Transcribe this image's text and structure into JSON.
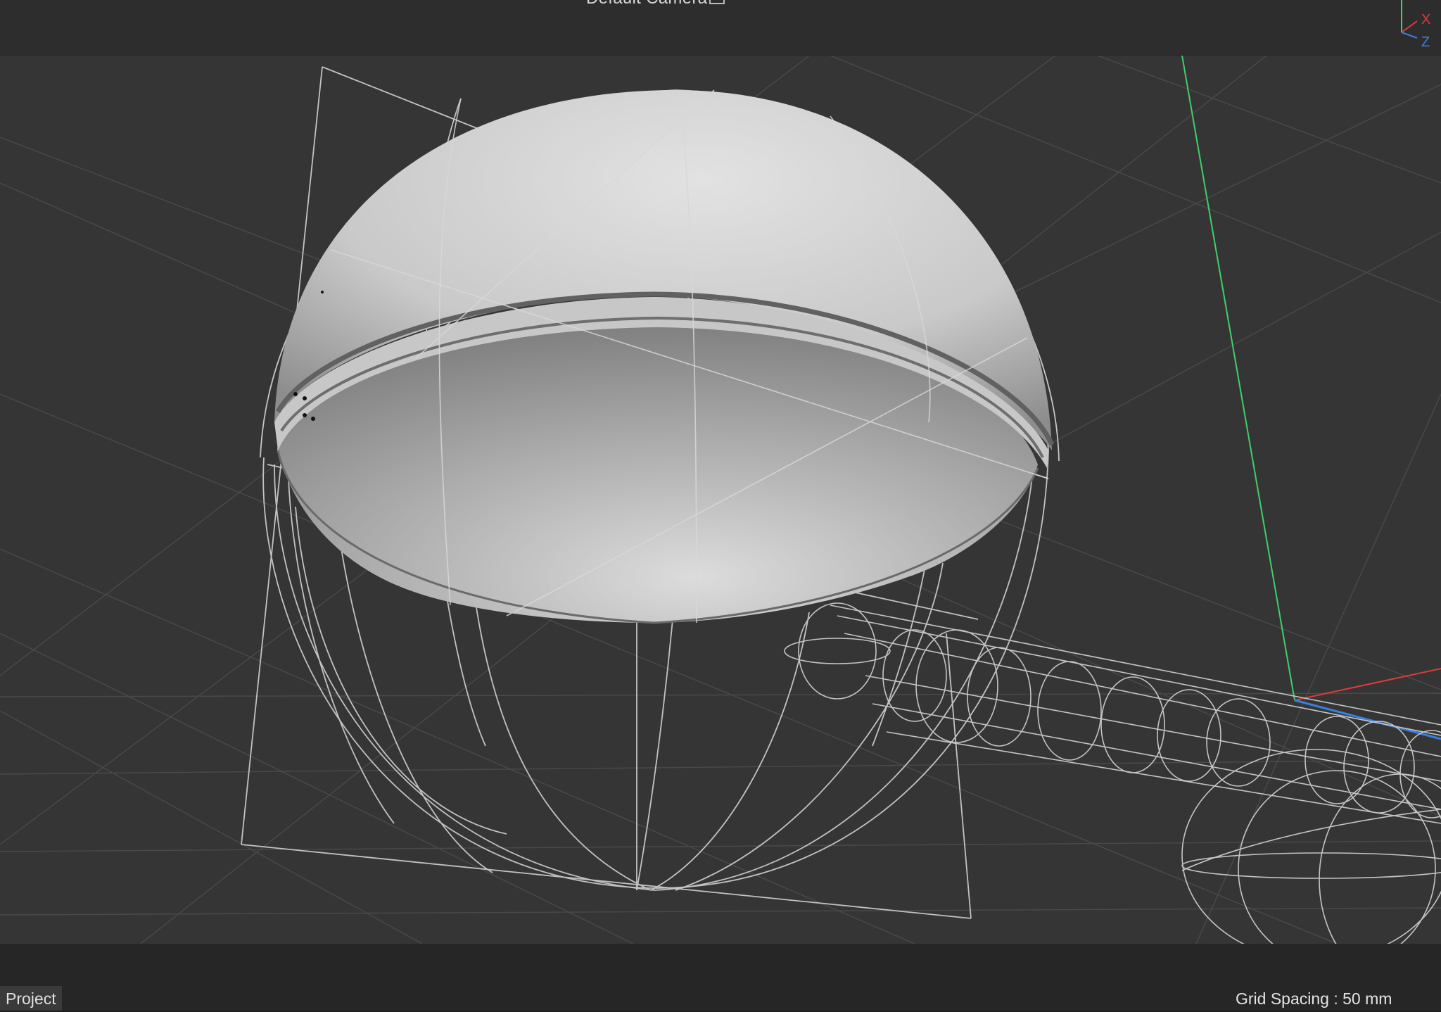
{
  "viewport": {
    "camera_label": "Default Camera",
    "camera_icon": "camera-icon"
  },
  "axis_gizmo": {
    "x_label": "X",
    "z_label": "Z",
    "x_color": "#e03a3a",
    "y_color": "#3fd06a",
    "z_color": "#3a7fe0"
  },
  "status_bar": {
    "project_tab": "Project",
    "grid_spacing": "Grid Spacing : 50 mm"
  },
  "colors": {
    "viewport_bg": "#353535",
    "grid_line": "#4a4a4a",
    "wireframe": "#c8c8c8",
    "y_axis": "#3fd06a",
    "x_axis": "#e03a3a",
    "z_axis": "#3a7fe0"
  }
}
